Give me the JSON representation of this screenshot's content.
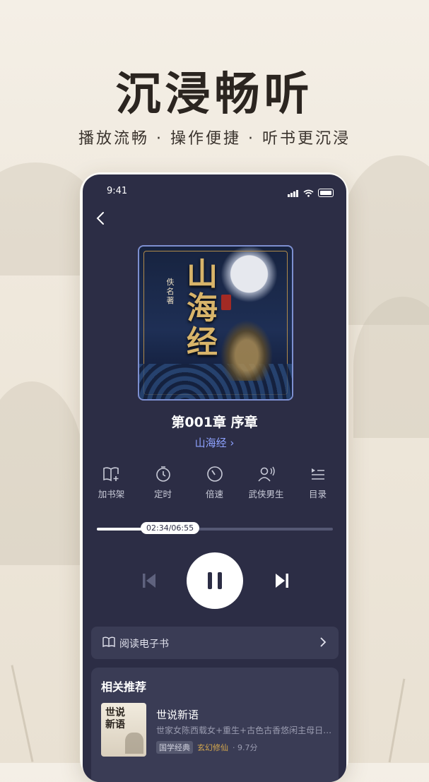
{
  "headline": "沉浸畅听",
  "subline": "播放流畅 · 操作便捷 · 听书更沉浸",
  "status": {
    "time": "9:41"
  },
  "cover": {
    "title": "山海经",
    "author": "佚名著"
  },
  "player": {
    "chapter": "第001章 序章",
    "book_link": "山海经",
    "progress_label": "02:34/06:55",
    "progress_fraction": 0.37
  },
  "actions": [
    {
      "label": "加书架",
      "icon": "bookshelf-add-icon"
    },
    {
      "label": "定时",
      "icon": "timer-icon"
    },
    {
      "label": "倍速",
      "icon": "speed-icon"
    },
    {
      "label": "武侠男生",
      "icon": "voice-icon"
    },
    {
      "label": "目录",
      "icon": "playlist-icon"
    }
  ],
  "read_ebook": {
    "label": "阅读电子书"
  },
  "related": {
    "heading": "相关推荐",
    "items": [
      {
        "cover_title": "世说新语",
        "title": "世说新语",
        "desc": "世家女陈西载女+重生+古色古香悠闲主母日…",
        "tag": "国学经典",
        "category": "玄幻修仙",
        "score": "· 9.7分"
      }
    ]
  },
  "colors": {
    "screen_bg": "#2c2d45",
    "accent_link": "#8ea2ff",
    "category": "#d7a94d"
  }
}
